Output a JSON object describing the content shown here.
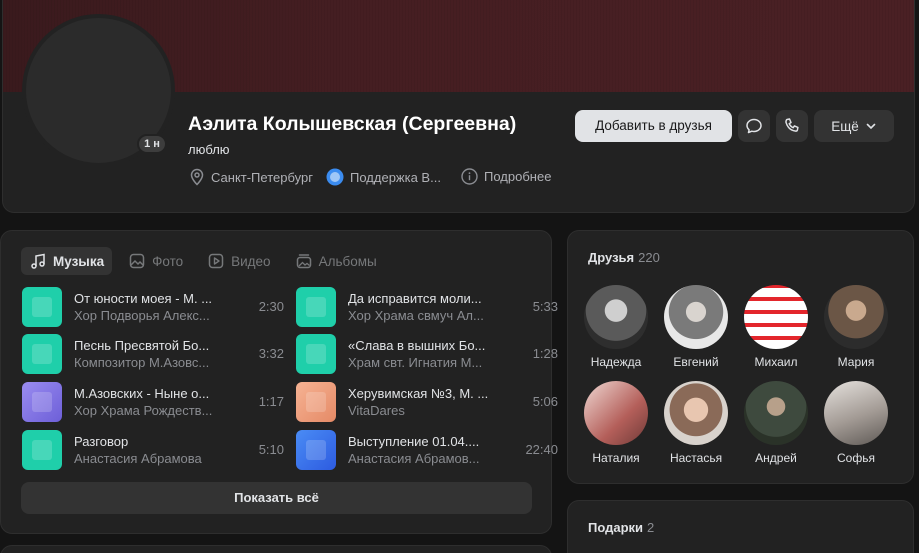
{
  "profile": {
    "name": "Аэлита Колышевская (Сергеевна)",
    "status": "люблю",
    "avatar_badge": "1 н",
    "city": "Санкт-Петербург",
    "support": "Поддержка В...",
    "details": "Подробнее",
    "add_friend": "Добавить в друзья",
    "more": "Ещё"
  },
  "tabs": [
    {
      "label": "Музыка",
      "icon": "music-note-icon",
      "active": true
    },
    {
      "label": "Фото",
      "icon": "photo-icon",
      "active": false
    },
    {
      "label": "Видео",
      "icon": "video-icon",
      "active": false
    },
    {
      "label": "Альбомы",
      "icon": "albums-icon",
      "active": false
    }
  ],
  "tracks": [
    {
      "title": "От юности моея - М. ...",
      "artist": "Хор Подворья Алекс...",
      "duration": "2:30",
      "cover": "#1fcfaa"
    },
    {
      "title": "Да исправится моли...",
      "artist": "Хор Храма свмуч Ал...",
      "duration": "5:33",
      "cover": "#1fcfaa"
    },
    {
      "title": "Песнь Пресвятой Бо...",
      "artist": "Композитор М.Азовс...",
      "duration": "3:32",
      "cover": "#1fcfaa"
    },
    {
      "title": "«Слава в вышних Бо...",
      "artist": "Храм свт. Игнатия М...",
      "duration": "1:28",
      "cover": "#1fcfaa"
    },
    {
      "title": "М.Азовских - Ныне о...",
      "artist": "Хор Храма Рождеств...",
      "duration": "1:17",
      "cover": "#8b7ee8"
    },
    {
      "title": "Херувимская №3, М. ...",
      "artist": "VitaDares",
      "duration": "5:06",
      "cover": "#f0a07e"
    },
    {
      "title": "Разговор",
      "artist": "Анастасия Абрамова",
      "duration": "5:10",
      "cover": "#1fcfaa"
    },
    {
      "title": "Выступление 01.04....",
      "artist": "Анастасия Абрамов...",
      "duration": "22:40",
      "cover": "#3d7cf0"
    }
  ],
  "show_all": "Показать всё",
  "friends": {
    "title": "Друзья",
    "count": "220",
    "list": [
      {
        "name": "Надежда",
        "color": "#6a6a6a"
      },
      {
        "name": "Евгений",
        "color": "#8d8d8d"
      },
      {
        "name": "Михаил",
        "color": "#e83a3a"
      },
      {
        "name": "Мария",
        "color": "#5a4a3e"
      },
      {
        "name": "Наталия",
        "color": "#c98a86"
      },
      {
        "name": "Настасья",
        "color": "#b39686"
      },
      {
        "name": "Андрей",
        "color": "#4a5a4a"
      },
      {
        "name": "Софья",
        "color": "#9a9490"
      }
    ]
  },
  "gifts": {
    "title": "Подарки",
    "count": "2"
  }
}
